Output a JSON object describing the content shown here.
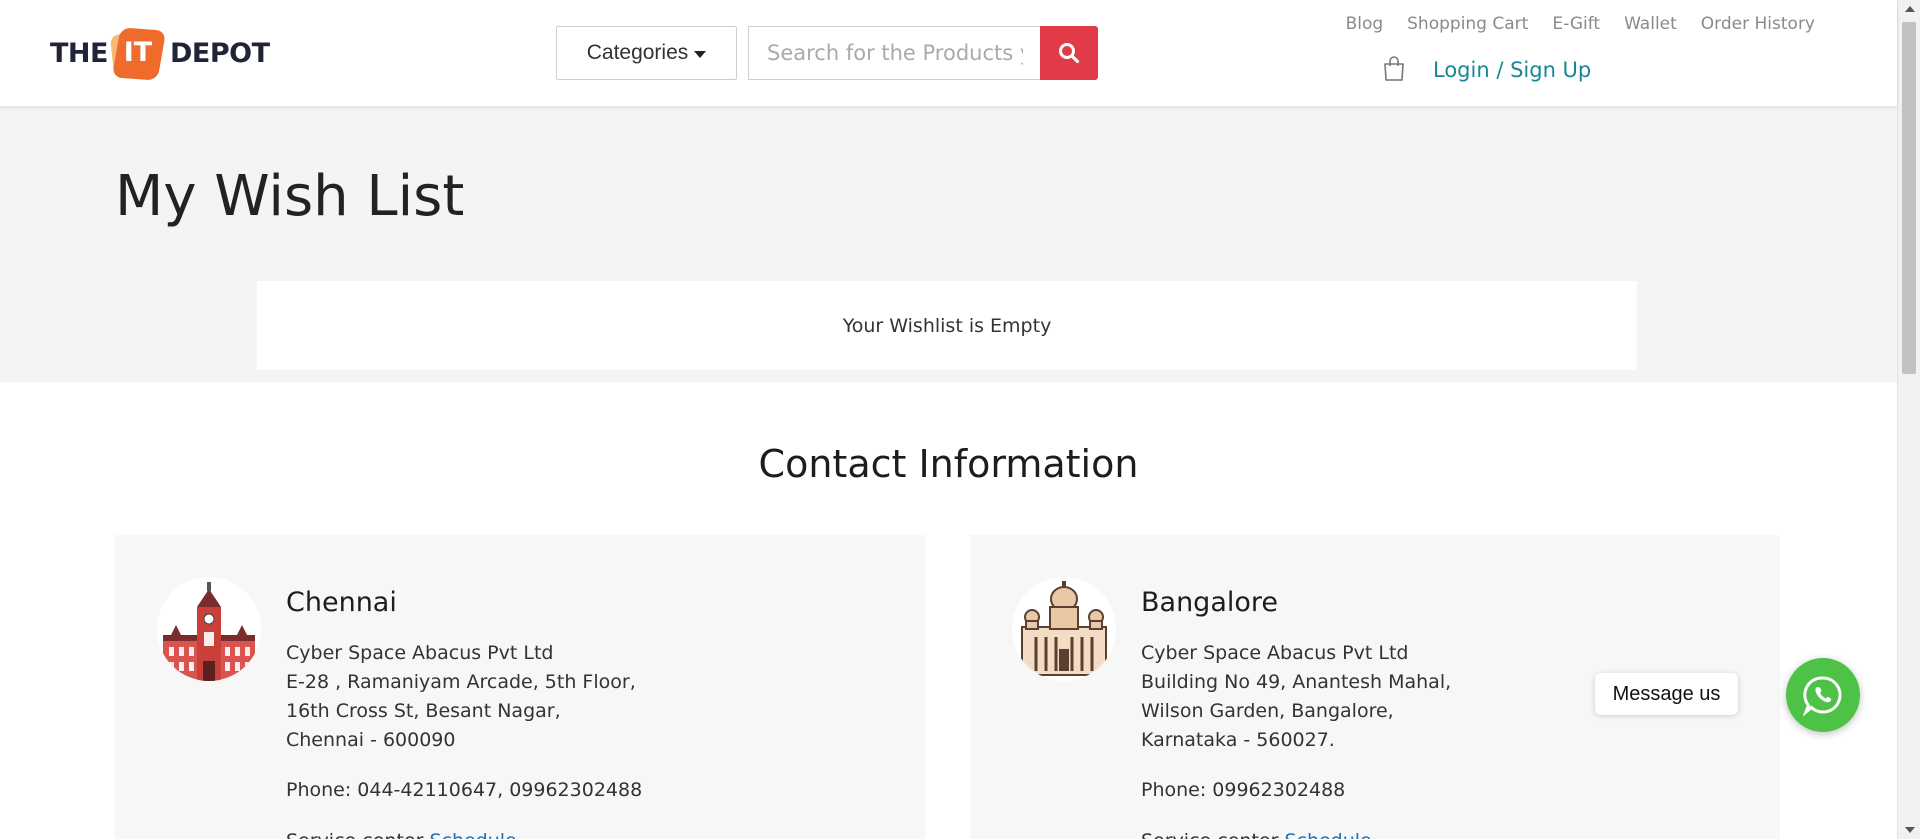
{
  "header": {
    "logo": {
      "word1": "THE",
      "badge": "IT",
      "word2": "DEPOT"
    },
    "categories_label": "Categories",
    "search": {
      "placeholder": "Search for the Products you",
      "value": ""
    },
    "nav": [
      {
        "label": "Blog"
      },
      {
        "label": "Shopping Cart"
      },
      {
        "label": "E-Gift"
      },
      {
        "label": "Wallet"
      },
      {
        "label": "Order History"
      }
    ],
    "login_label": "Login / Sign Up"
  },
  "wishlist": {
    "title": "My Wish List",
    "empty_message": "Your Wishlist is Empty"
  },
  "contact": {
    "title": "Contact Information",
    "cards": [
      {
        "city": "Chennai",
        "company": "Cyber Space Abacus Pvt Ltd",
        "line1": "E-28 , Ramaniyam Arcade, 5th Floor,",
        "line2": "16th Cross St, Besant Nagar,",
        "line3": "Chennai - 600090",
        "phone": "Phone: 044-42110647, 09962302488",
        "more_prefix": "Service center",
        "more_link": "Schedule"
      },
      {
        "city": "Bangalore",
        "company": "Cyber Space Abacus Pvt Ltd",
        "line1": "Building No 49, Anantesh Mahal,",
        "line2": "Wilson Garden, Bangalore,",
        "line3": "Karnataka - 560027.",
        "phone": "Phone: 09962302488",
        "more_prefix": "Service center",
        "more_link": "Schedule"
      }
    ]
  },
  "whatsapp": {
    "message_label": "Message us"
  },
  "colors": {
    "accent_red": "#e23a46",
    "link_teal": "#198796",
    "logo_orange": "#ef6b2c",
    "whatsapp_green": "#4dc247"
  },
  "icons": [
    "search-icon",
    "cart-icon",
    "caret-down-icon",
    "whatsapp-icon",
    "chennai-building-icon",
    "bangalore-palace-icon"
  ]
}
